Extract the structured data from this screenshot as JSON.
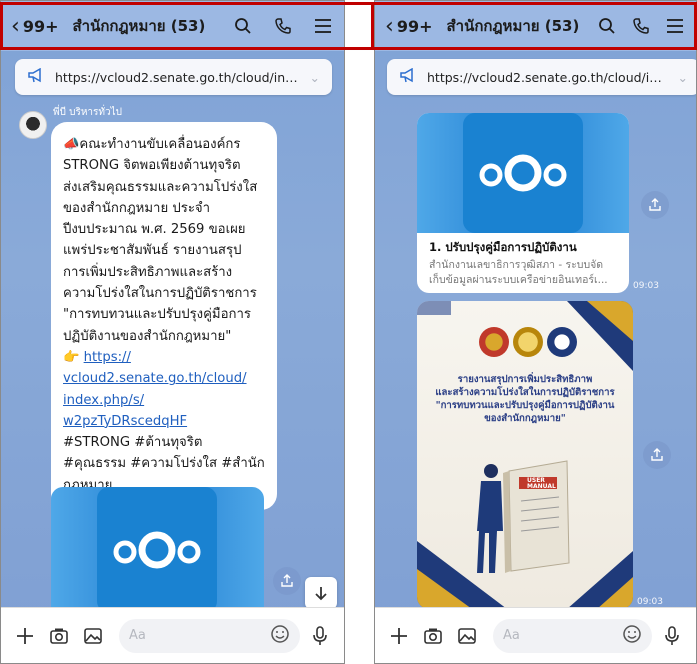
{
  "header": {
    "back_count": "99+",
    "chat_title": "สำนักกฎหมาย (53)"
  },
  "pinned": {
    "url": "https://vcloud2.senate.go.th/cloud/inde..."
  },
  "left": {
    "sender_name": "พี่บี บริหารทั่วไป",
    "message_lines": [
      "📣คณะทำงานขับเคลื่อนองค์กร",
      "STRONG จิตพอเพียงต้านทุจริต",
      "ส่งเสริมคุณธรรมและความโปร่งใส",
      "ของสำนักกฎหมาย ประจำ",
      "ปีงบประมาณ พ.ศ. 2569 ขอเผย",
      "แพร่ประชาสัมพันธ์ รายงานสรุป",
      "การเพิ่มประสิทธิภาพและสร้าง",
      "ความโปร่งใสในการปฏิบัติราชการ",
      "\"การทบทวนและปรับปรุงคู่มือการ",
      "ปฏิบัติงานของสำนักกฎหมาย\""
    ],
    "link_prefix": "👉 ",
    "link_lines": [
      "https://",
      "vcloud2.senate.go.th/cloud/",
      "index.php/s/",
      "w2pzTyDRscedqHF"
    ],
    "hashtag_lines": [
      "#STRONG #ต้านทุจริต",
      "#คุณธรรม #ความโปร่งใส #สำนัก",
      "กฎหมาย"
    ]
  },
  "right": {
    "card_title": "1. ปรับปรุงคู่มือการปฏิบัติงาน",
    "card_subtitle_1": "สำนักงานเลขาธิการวุฒิสภา - ระบบจัด",
    "card_subtitle_2": "เก็บข้อมูลผ่านระบบเครือข่ายอินเทอร์เ...",
    "card_time": "09:03",
    "poster_lines": [
      "รายงานสรุปการเพิ่มประสิทธิภาพ",
      "และสร้างความโปร่งใสในการปฏิบัติราชการ",
      "\"การทบทวนและปรับปรุงคู่มือการปฏิบัติงาน",
      "ของสำนักกฎหมาย\""
    ],
    "poster_manual_label": "USER MANUAL",
    "poster_time": "09:03"
  },
  "input": {
    "placeholder": "Aa"
  },
  "colors": {
    "chat_bg": "#8aaad8",
    "header_bg": "#9cb8e3",
    "highlight_outline": "#c00000",
    "link": "#1f5fbf",
    "nextcloud_blue": "#1a82d1"
  }
}
